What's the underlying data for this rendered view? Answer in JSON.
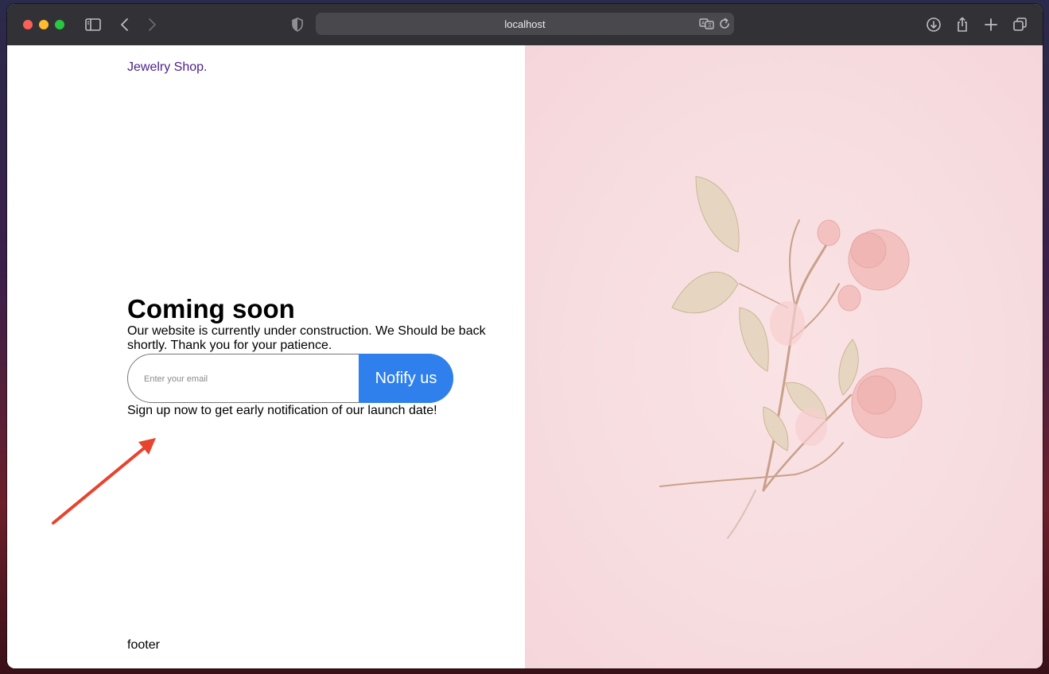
{
  "browser": {
    "url": "localhost",
    "traffic_lights": [
      "#fe5f57",
      "#febc2e",
      "#28c840"
    ]
  },
  "page": {
    "logo": "Jewelry Shop.",
    "heading": "Coming soon",
    "description": "Our website is currently under construction. We Should be back shortly. Thank you for your patience.",
    "email_placeholder": "Enter your email",
    "notify_button": "Nofify us",
    "signup_text": "Sign up now to get early notification of our launch date!",
    "footer": "footer"
  },
  "colors": {
    "accent_button": "#2f80ed",
    "logo": "#4b1f8c",
    "annotation_arrow": "#e8432e",
    "hero_background": "#f7dde0"
  },
  "icons": [
    "sidebar-icon",
    "back-icon",
    "forward-icon",
    "privacy-shield-icon",
    "translate-icon",
    "reload-icon",
    "download-icon",
    "share-icon",
    "new-tab-icon",
    "tab-overview-icon",
    "annotation-arrow-icon",
    "rose-flower-image"
  ]
}
